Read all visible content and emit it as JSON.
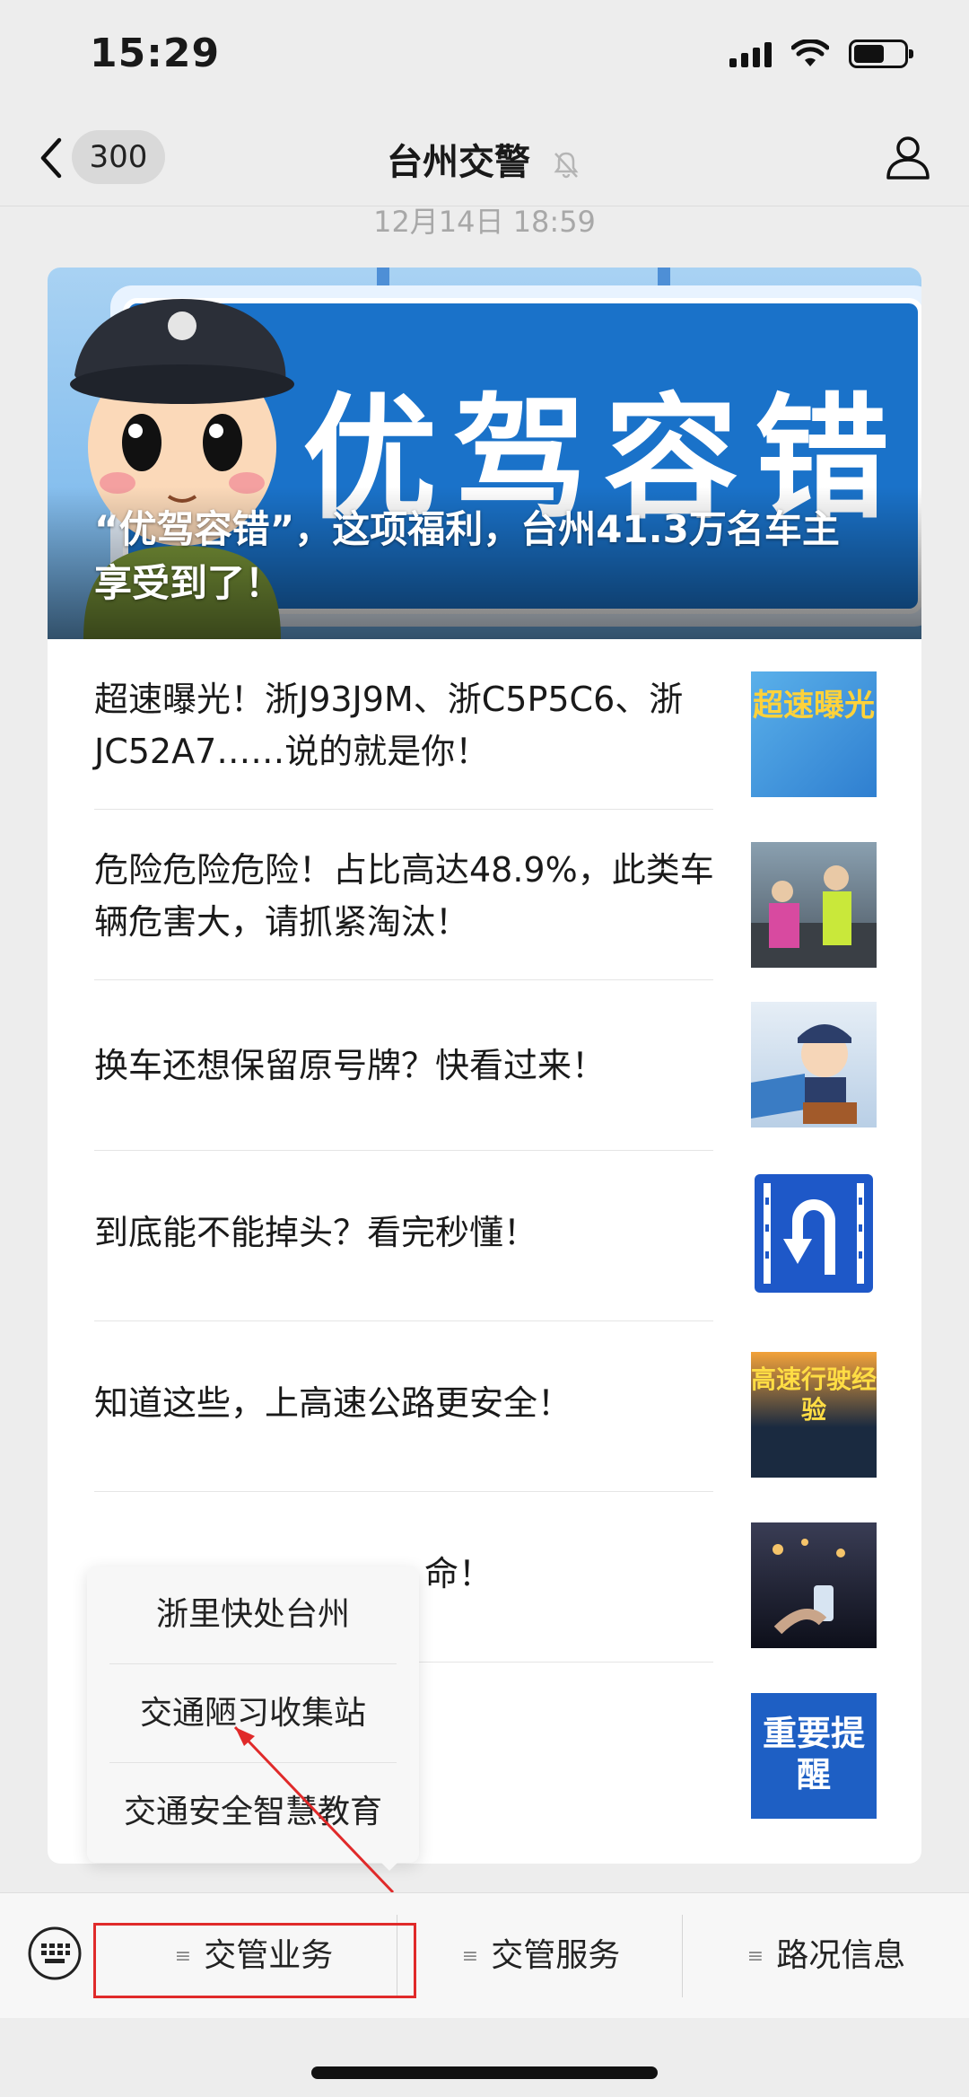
{
  "status_bar": {
    "time": "15:29"
  },
  "nav": {
    "unread_count": "300",
    "title": "台州交警",
    "muted_icon": "bell-muted-icon",
    "profile_icon": "person-icon"
  },
  "date": "12月14日 18:59",
  "cover": {
    "sign_text": "优驾容错",
    "title": "“优驾容错”，这项福利，台州41.3万名车主享受到了！"
  },
  "articles": [
    {
      "title": "超速曝光！浙J93J9M、浙C5P5C6、浙JC52A7……说的就是你！",
      "thumb_text": "超速曝光"
    },
    {
      "title": "危险危险危险！占比高达48.9%，此类车辆危害大，请抓紧淘汰！",
      "thumb_text": ""
    },
    {
      "title": "换车还想保留原号牌？快看过来！",
      "thumb_text": ""
    },
    {
      "title": "到底能不能掉头？看完秒懂！",
      "thumb_text": ""
    },
    {
      "title": "知道这些，上高速公路更安全！",
      "thumb_text": "高速行驶经验"
    },
    {
      "title": "命！",
      "thumb_text": ""
    },
    {
      "title": "",
      "thumb_text": "重要提醒"
    }
  ],
  "popup_menu": [
    "浙里快处台州",
    "交通陋习收集站",
    "交通安全智慧教育"
  ],
  "bottom_menu": [
    "交管业务",
    "交管服务",
    "路况信息"
  ],
  "colors": {
    "highlight": "#e02a2a",
    "accent_blue": "#1a72c9"
  }
}
